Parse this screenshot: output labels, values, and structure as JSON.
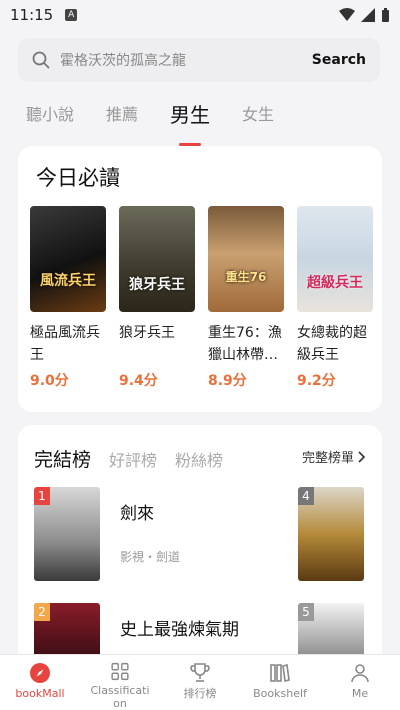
{
  "status": {
    "time": "11:15",
    "badge": "A"
  },
  "search": {
    "placeholder": "霍格沃茨的孤高之龍",
    "button": "Search"
  },
  "tabs": [
    {
      "label": "聽小說"
    },
    {
      "label": "推薦"
    },
    {
      "label": "男生"
    },
    {
      "label": "女生"
    }
  ],
  "must_read": {
    "title": "今日必讀",
    "books": [
      {
        "title": "極品風流兵王",
        "score": "9.0分",
        "cover_text": "風流兵王"
      },
      {
        "title": "狼牙兵王",
        "score": "9.4分",
        "cover_text": "狼牙兵王"
      },
      {
        "title": "重生76：漁獵山林帶…",
        "score": "8.9分",
        "cover_text": "重生76"
      },
      {
        "title": "女總裁的超級兵王",
        "score": "9.2分",
        "cover_text": "超級兵王"
      }
    ]
  },
  "rank": {
    "tabs": [
      {
        "label": "完結榜"
      },
      {
        "label": "好評榜"
      },
      {
        "label": "粉絲榜"
      }
    ],
    "more": "完整榜單",
    "items": [
      {
        "num": "1",
        "name": "劍來",
        "tag": "影視・劍道"
      },
      {
        "num": "2",
        "name": "史上最強煉氣期",
        "tag": ""
      }
    ],
    "side": [
      {
        "num": "4"
      },
      {
        "num": "5"
      }
    ]
  },
  "nav": [
    {
      "label": "bookMall",
      "icon": "compass-icon"
    },
    {
      "label": "Classification",
      "icon": "grid-icon"
    },
    {
      "label": "排行榜",
      "icon": "trophy-icon"
    },
    {
      "label": "Bookshelf",
      "icon": "books-icon"
    },
    {
      "label": "Me",
      "icon": "person-icon"
    }
  ],
  "colors": {
    "accent": "#e8443f",
    "score": "#e8703a"
  }
}
